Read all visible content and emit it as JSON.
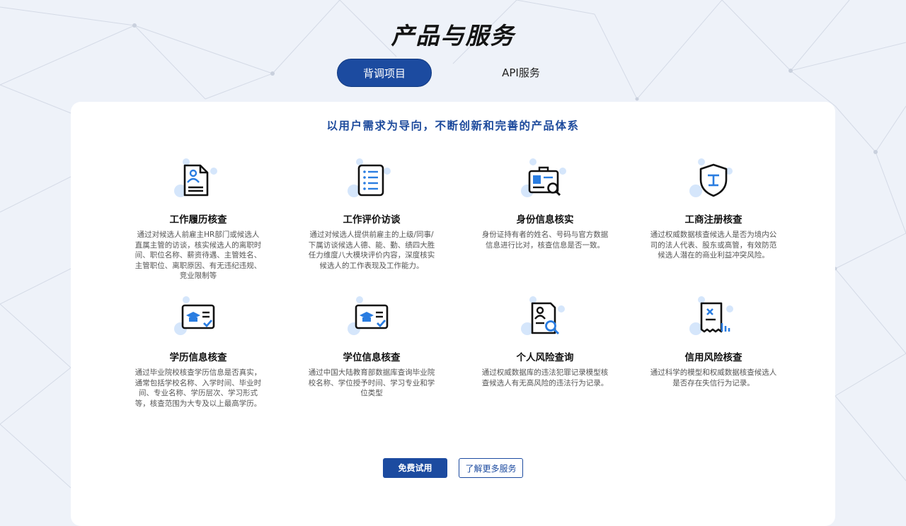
{
  "page_title": "产品与服务",
  "tabs": [
    {
      "label": "背调项目",
      "active": true
    },
    {
      "label": "API服务",
      "active": false
    }
  ],
  "slogan": "以用户需求为导向，不断创新和完善的产品体系",
  "items": [
    {
      "icon": "resume-icon",
      "title": "工作履历核查",
      "desc": "通过对候选人前雇主HR部门或候选人直属主管的访谈，核实候选人的离职时间、职位名称、薪资待遇、主管姓名、主管职位、离职原因、有无违纪违规、竞业限制等"
    },
    {
      "icon": "list-document-icon",
      "title": "工作评价访谈",
      "desc": "通过对候选人提供前雇主的上级/同事/下属访谈候选人德、能、勤、绩四大胜任力维度八大模块评价内容，深度核实候选人的工作表现及工作能力。"
    },
    {
      "icon": "id-card-search-icon",
      "title": "身份信息核实",
      "desc": "身份证持有者的姓名、号码与官方数据信息进行比对，核查信息是否一致。"
    },
    {
      "icon": "shield-business-icon",
      "title": "工商注册核查",
      "desc": "通过权威数据核查候选人是否为境内公司的法人代表、股东或高管，有效防范候选人潜在的商业利益冲突风险。"
    },
    {
      "icon": "education-certificate-icon",
      "title": "学历信息核查",
      "desc": "通过毕业院校核查学历信息是否真实，通常包括学校名称、入学时间、毕业时间、专业名称、学历层次、学习形式等，核查范围为大专及以上最高学历。"
    },
    {
      "icon": "degree-certificate-icon",
      "title": "学位信息核查",
      "desc": "通过中国大陆教育部数据库查询毕业院校名称、学位授予时间、学习专业和学位类型"
    },
    {
      "icon": "personal-risk-search-icon",
      "title": "个人风险查询",
      "desc": "通过权威数据库的违法犯罪记录模型核查候选人有无高风险的违法行为记录。"
    },
    {
      "icon": "credit-risk-icon",
      "title": "信用风险核查",
      "desc": "通过科学的模型和权威数据核查候选人是否存在失信行为记录。"
    }
  ],
  "buttons": {
    "trial": "免费试用",
    "more": "了解更多服务"
  },
  "colors": {
    "brand": "#1c4ba0",
    "icon_accent": "#2a7de1",
    "icon_bubble": "#d5e6fb",
    "background": "#eef2f9"
  }
}
